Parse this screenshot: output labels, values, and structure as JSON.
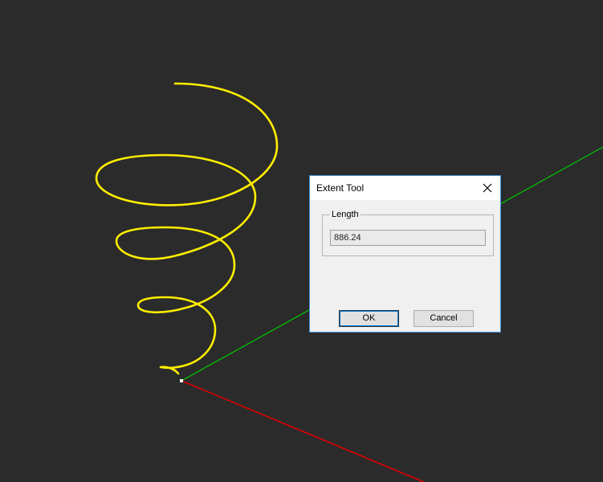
{
  "dialog": {
    "title": "Extent Tool",
    "close_icon": "close-icon",
    "group_label": "Length",
    "length_value": "886.24",
    "ok_label": "OK",
    "cancel_label": "Cancel"
  },
  "colors": {
    "background": "#2b2b2b",
    "helix": "#ffee00",
    "axis_y": "#00cc00",
    "axis_x": "#dd0000",
    "dialog_border": "#3c8fd4"
  }
}
